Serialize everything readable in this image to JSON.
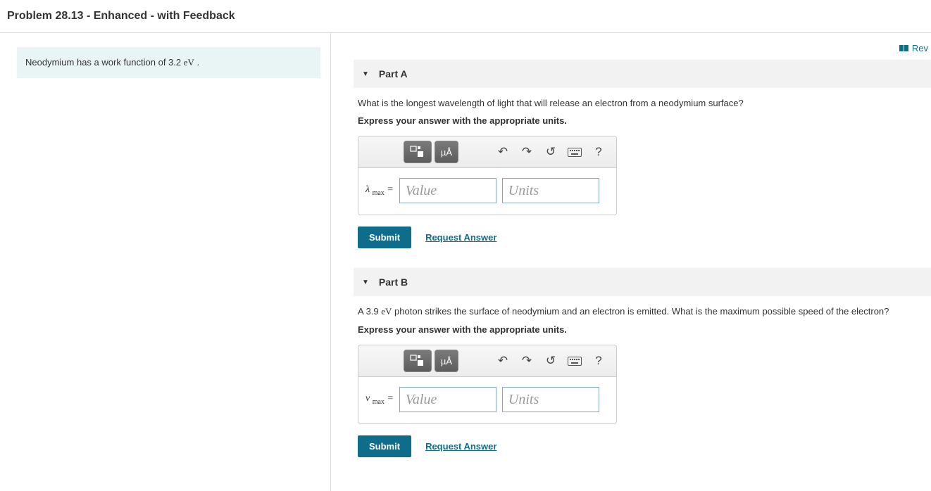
{
  "page_title": "Problem 28.13 - Enhanced - with Feedback",
  "top_link": {
    "label": "Rev"
  },
  "info": {
    "prefix": "Neodymium has a work function of 3.2 ",
    "unit_html": "eV",
    "suffix": " ."
  },
  "parts": {
    "a": {
      "label": "Part A",
      "question": "What is the longest wavelength of light that will release an electron from a neodymium surface?",
      "instruction": "Express your answer with the appropriate units.",
      "variable_symbol": "λ",
      "variable_sub": "max",
      "value_placeholder": "Value",
      "units_placeholder": "Units",
      "submit_label": "Submit",
      "request_label": "Request Answer"
    },
    "b": {
      "label": "Part B",
      "question_prefix": "A 3.9 ",
      "question_unit": "eV",
      "question_suffix": " photon strikes the surface of neodymium and an electron is emitted. What is the maximum possible speed of the electron?",
      "instruction": "Express your answer with the appropriate units.",
      "variable_symbol": "v",
      "variable_sub": "max",
      "value_placeholder": "Value",
      "units_placeholder": "Units",
      "submit_label": "Submit",
      "request_label": "Request Answer"
    }
  },
  "toolbar_unit_label": "µÅ"
}
